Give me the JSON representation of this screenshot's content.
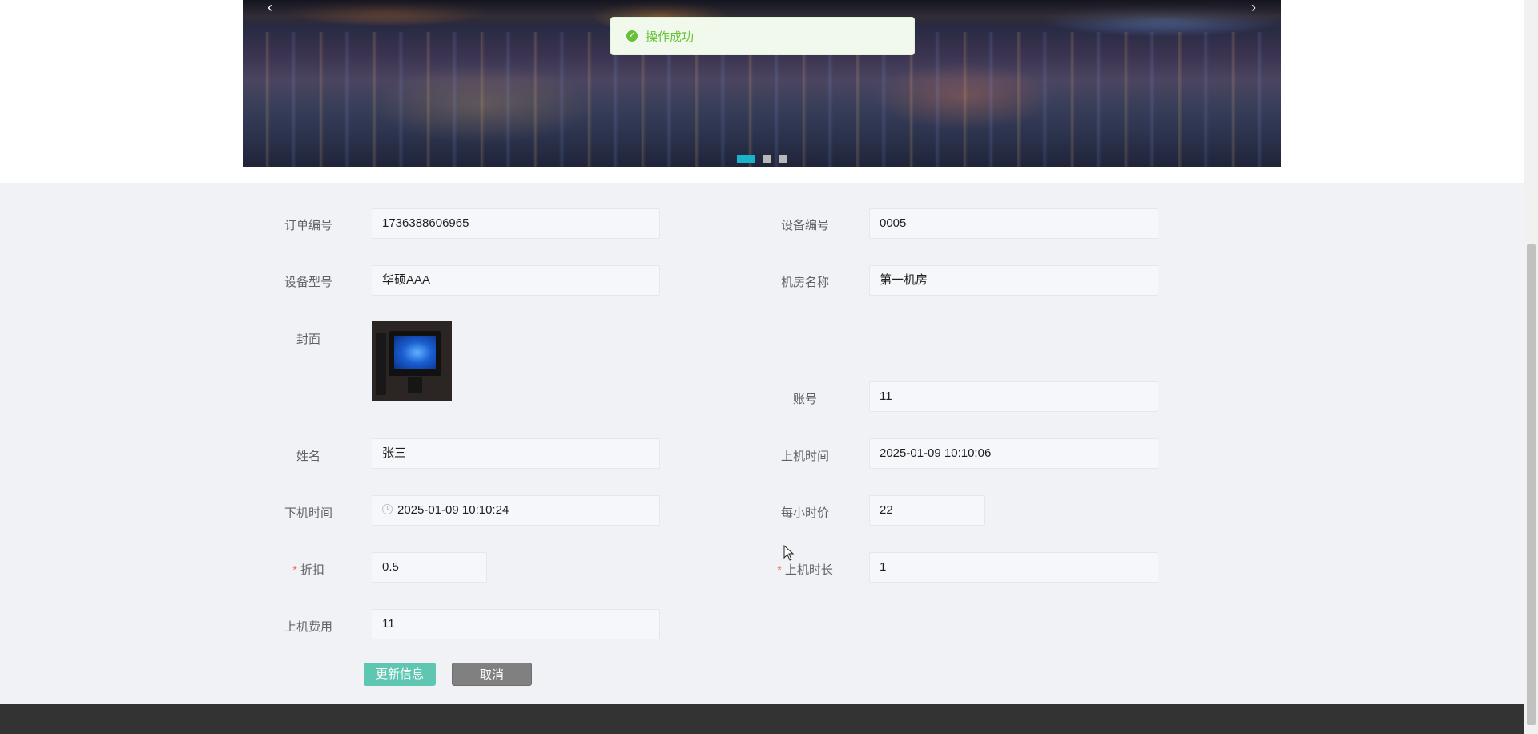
{
  "carousel": {
    "prev_icon": "‹",
    "next_icon": "›",
    "slides": 3,
    "active_slide": 1
  },
  "toast": {
    "icon": "check-circle-icon",
    "message": "操作成功",
    "color": "#67c23a"
  },
  "form": {
    "order_no": {
      "label": "订单编号",
      "value": "1736388606965"
    },
    "device_no": {
      "label": "设备编号",
      "value": "0005"
    },
    "device_model": {
      "label": "设备型号",
      "value": "华硕AAA"
    },
    "room_name": {
      "label": "机房名称",
      "value": "第一机房"
    },
    "cover": {
      "label": "封面"
    },
    "account": {
      "label": "账号",
      "value": "11"
    },
    "name": {
      "label": "姓名",
      "value": "张三"
    },
    "start_time": {
      "label": "上机时间",
      "value": "2025-01-09 10:10:06"
    },
    "end_time": {
      "label": "下机时间",
      "value": "2025-01-09 10:10:24"
    },
    "hourly_price": {
      "label": "每小时价",
      "value": "22"
    },
    "discount": {
      "label": "折扣",
      "value": "0.5",
      "required": true
    },
    "duration": {
      "label": "上机时长",
      "value": "1",
      "required": true
    },
    "fee": {
      "label": "上机费用",
      "value": "11"
    },
    "required_mark": "*"
  },
  "buttons": {
    "update_label": "更新信息",
    "cancel_label": "取消"
  },
  "colors": {
    "primary_button": "#5fc7b1",
    "cancel_button": "#808080",
    "indicator_active": "#19b4cc",
    "footer": "#333333"
  }
}
